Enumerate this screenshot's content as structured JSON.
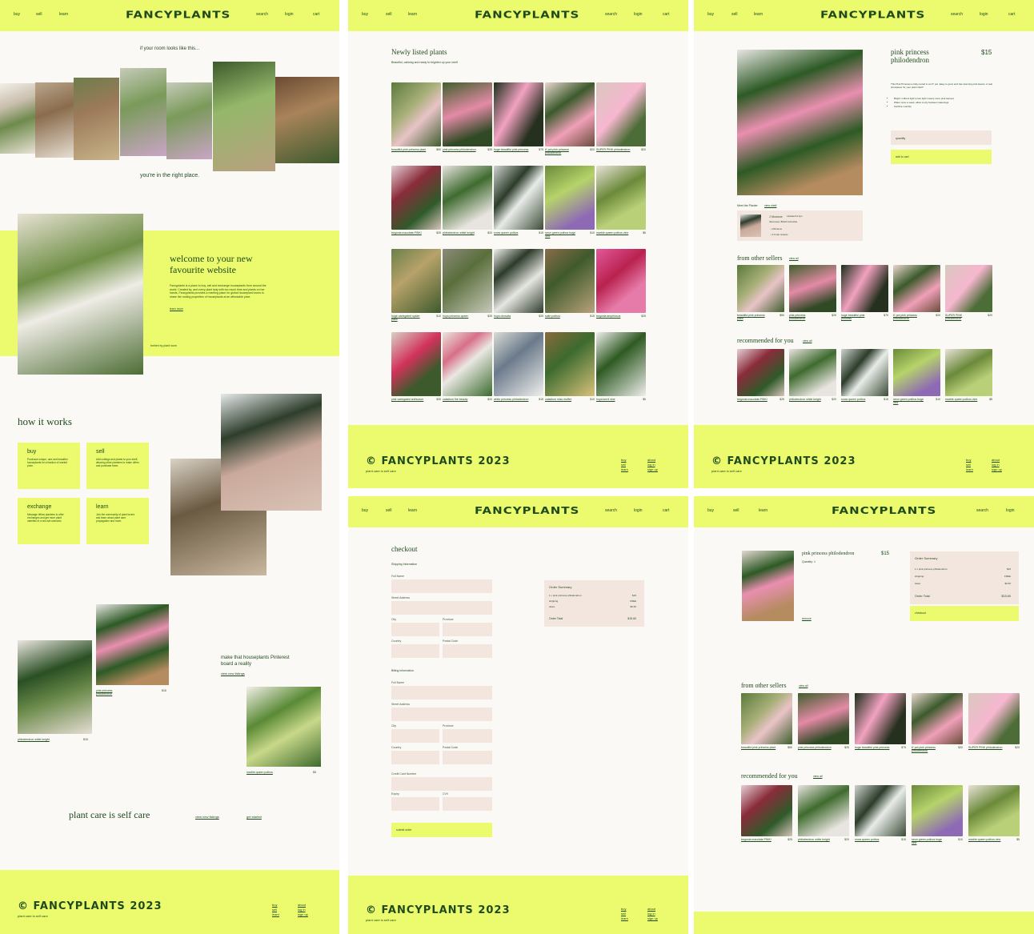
{
  "brand": "FANCYPLANTS",
  "nav": {
    "buy": "buy",
    "sell": "sell",
    "learn": "learn",
    "search": "search",
    "login": "login",
    "cart": "cart"
  },
  "footer": {
    "logo": "© FANCYPLANTS 2023",
    "tagline": "plant care is self care",
    "links": [
      "buy",
      "sell",
      "learn",
      "about",
      "log in",
      "sign up"
    ]
  },
  "home": {
    "intro_top": "if your room looks like this...",
    "intro_bottom": "you're in the right place.",
    "welcome_title": "welcome to your new favourite website",
    "welcome_body": "Fancyplants is a place to buy, sell and exchange houseplants from around the world. Created by, and every plant lady with too much time and plants on her hands, Fancyplants provides a meeting place for global houseplant lovers to share the rooting properties of houseplants at an affordable price.",
    "learn_more": "learn more",
    "photo_credit": "bmhen by plant room",
    "how_title": "how it works",
    "how": [
      {
        "title": "buy",
        "body": "Purchase unique, rare and beautiful houseplants for a fraction of market price."
      },
      {
        "title": "sell",
        "body": "Add cuttings and plants to your shelf, allowing other plantees to make offers and purchase them."
      },
      {
        "title": "exchange",
        "body": "Message fellow plantees to offer exchanges and get more plant varieties in a win-win scenario."
      },
      {
        "title": "learn",
        "body": "Join the community of plant lovers and learn about plant care, propagation and more."
      }
    ],
    "pinterest": "make that houseplants Pinterest board a reality",
    "view_new": "view new listings",
    "feature_items": [
      {
        "name": "pink princess philodendron",
        "price": "$15"
      },
      {
        "name": "philodendron white knight",
        "price": "$15"
      },
      {
        "name": "marble queen pothos",
        "price": "$5"
      }
    ],
    "closing": "plant care is self care",
    "closing_links": [
      "view new listings",
      "get started"
    ]
  },
  "listings": {
    "title": "Newly listed plants",
    "subtitle": "Beautiful, calming and ready to brighten up your shelf",
    "items": [
      {
        "name": "beautiful pink princess plant",
        "price": "$50"
      },
      {
        "name": "pink princess philodendron",
        "price": "$25"
      },
      {
        "name": "huge beautiful pink princess",
        "price": "$75"
      },
      {
        "name": "6' pot pink princess philodendron",
        "price": "$20"
      },
      {
        "name": "SUPER PINK philodendron",
        "price": "$20"
      },
      {
        "name": "begonia maculata PINK!",
        "price": "$25"
      },
      {
        "name": "philodendron white knight",
        "price": "$20"
      },
      {
        "name": "snow queen pothos",
        "price": "$15"
      },
      {
        "name": "neon green pothos huge vine",
        "price": "$10"
      },
      {
        "name": "marble queen pothos vine",
        "price": "$5"
      },
      {
        "name": "huge variegated spider plant",
        "price": "$10"
      },
      {
        "name": "hoya princess queen",
        "price": "$25"
      },
      {
        "name": "hoya obovata",
        "price": "$25"
      },
      {
        "name": "satin pothos",
        "price": "$15"
      },
      {
        "name": "begonia amphioxus",
        "price": "$25"
      },
      {
        "name": "pink variegated anthurium",
        "price": "$35"
      },
      {
        "name": "caladium fire beauty",
        "price": "$20"
      },
      {
        "name": "white princess philodendron",
        "price": "$15"
      },
      {
        "name": "caladium miss muffet",
        "price": "$10"
      },
      {
        "name": "hoya kerrii vine",
        "price": "$5"
      }
    ]
  },
  "product": {
    "title": "pink princess philodendron",
    "price": "$15",
    "desc": "This Pink Princess is fully rooted in an 6\" pot. Easy to grow and has stunning pink leaves. A real showpiece for your plant shelf!",
    "bullets": [
      "Bright, indirect light (more light means more pink leaves)",
      "Water once a week, allow to dry between waterings",
      "Fertilize monthly"
    ],
    "quantity_placeholder": "quantity",
    "add_to_cart": "add to cart",
    "meet": "Meet the Planter",
    "view_shelf": "view shelf",
    "seller_name": "J Monroe",
    "seller_note": "Vancouver, British Columbia",
    "seller_stats": [
      "150 items",
      "4.9 star reviews"
    ],
    "seller_joined": "cultivated for 4yrs",
    "from_other": "from other sellers",
    "recommended": "recommended for you",
    "view_all": "view all"
  },
  "checkout": {
    "title": "checkout",
    "shipping": "Shipping Information",
    "billing": "Billing Information",
    "fields": {
      "full_name": "Full Name",
      "street": "Street Address",
      "city": "City",
      "province": "Province",
      "country": "Country",
      "postal": "Postal Code",
      "card": "Credit Card Number",
      "expiry": "Expiry",
      "cvv": "CVV"
    },
    "submit": "submit order",
    "summary": {
      "title": "Order Summary",
      "line": "1 x pink princess philodendron",
      "line_price": "$15",
      "shipping": "shipping",
      "shipping_val": "FREE",
      "taxes": "taxes",
      "taxes_val": "$0.60",
      "total": "Order Total",
      "total_val": "$15.60"
    }
  },
  "cart": {
    "item": "pink princess philodendron",
    "qty": "Quantity: 1",
    "price": "$15",
    "remove": "remove",
    "checkout_btn": "checkout",
    "recommended": "recommended for you",
    "from_other": "from other sellers",
    "view_all": "view all"
  }
}
